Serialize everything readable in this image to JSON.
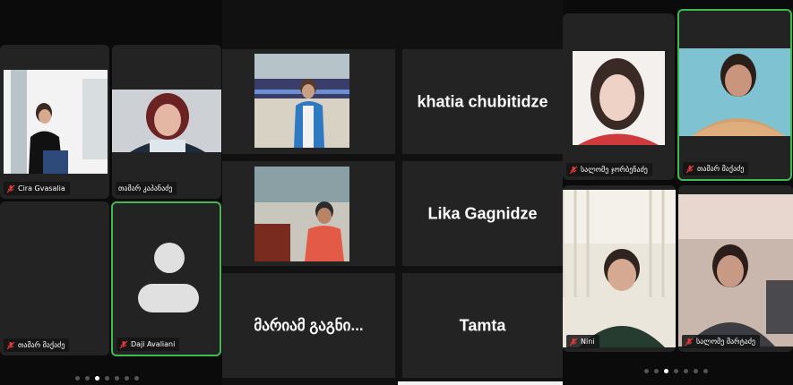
{
  "panels": {
    "left": {
      "tiles": [
        {
          "name": "Cira Gvasalia"
        },
        {
          "name": "თამარ კაპანაძე"
        },
        {
          "name": "თამარ მაქაძე"
        },
        {
          "name": "Daji Avaliani"
        }
      ],
      "page_dots": {
        "count": 7,
        "active": 2
      }
    },
    "middle": {
      "tiles": [
        {
          "name": "khatia chubitidze"
        },
        {
          "name": "Lika Gagnidze"
        },
        {
          "name": "მარიამ გაგნი..."
        },
        {
          "name": "Tamta"
        }
      ]
    },
    "right": {
      "tiles": [
        {
          "name": "სალომე ჯორბენაძე"
        },
        {
          "name": "თამარ მაქაძე"
        },
        {
          "name": "Nini"
        },
        {
          "name": "სალომე მარტაძე"
        }
      ],
      "page_dots": {
        "count": 7,
        "active": 2
      }
    }
  },
  "colors": {
    "active_border": "#3fb950",
    "mute_icon": "#e5393a",
    "tile_bg": "#232323"
  },
  "icons": {
    "muted_mic": "mic-muted-icon",
    "avatar": "person-placeholder-icon"
  }
}
